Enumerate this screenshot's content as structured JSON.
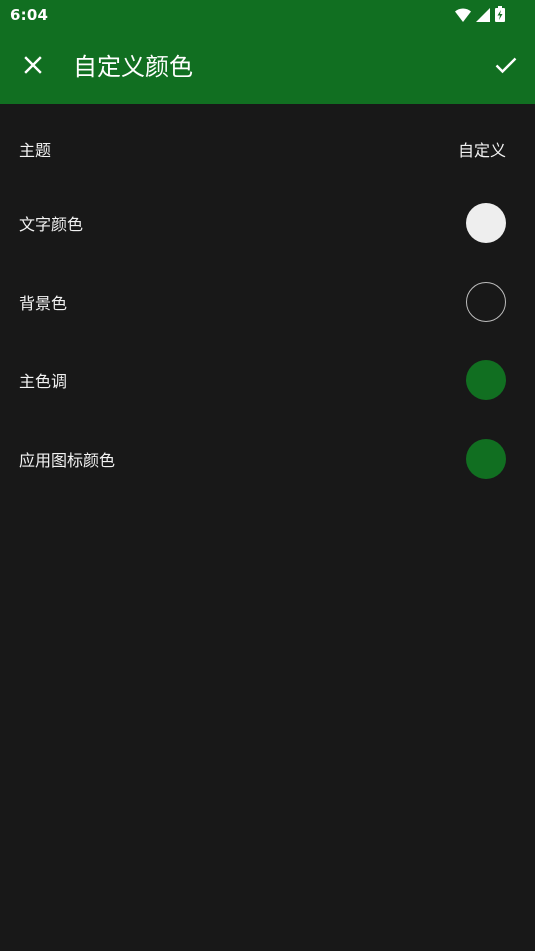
{
  "status_bar": {
    "time": "6:04",
    "bg": "#116f21"
  },
  "app_bar": {
    "title": "自定义颜色",
    "close_icon": "close-icon",
    "confirm_icon": "check-icon"
  },
  "settings": [
    {
      "label": "主题",
      "value": "自定义"
    },
    {
      "label": "文字颜色",
      "swatch_color": "#eeeeee"
    },
    {
      "label": "背景色",
      "swatch_color": "#181818"
    },
    {
      "label": "主色调",
      "swatch_color": "#116f21"
    },
    {
      "label": "应用图标颜色",
      "swatch_color": "#116f21"
    }
  ],
  "colors": {
    "accent": "#116f21",
    "background": "#181818",
    "text": "#f2f2f2"
  }
}
